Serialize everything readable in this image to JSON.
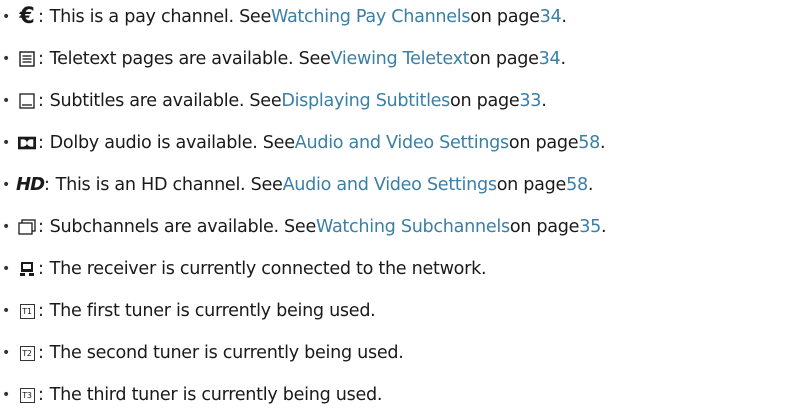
{
  "items": [
    {
      "icon": "euro-icon",
      "icon_text": "€",
      "pre": "This is a pay channel. See ",
      "link": "Watching Pay Channels",
      "mid": " on page ",
      "page": "34",
      "post": "."
    },
    {
      "icon": "teletext-icon",
      "pre": "Teletext pages are available. See ",
      "link": "Viewing Teletext",
      "mid": " on page ",
      "page": "34",
      "post": "."
    },
    {
      "icon": "subtitles-icon",
      "pre": "Subtitles are available. See ",
      "link": "Displaying Subtitles",
      "mid": " on page ",
      "page": "33",
      "post": "."
    },
    {
      "icon": "dolby-icon",
      "pre": "Dolby audio is available. See ",
      "link": "Audio and Video Settings",
      "mid": " on page ",
      "page": "58",
      "post": "."
    },
    {
      "icon": "hd-icon",
      "icon_text": "HD",
      "pre": "This is an HD channel. See ",
      "link": "Audio and Video Settings",
      "mid": " on page ",
      "page": "58",
      "post": "."
    },
    {
      "icon": "subchannels-icon",
      "pre": "Subchannels are available. See ",
      "link": "Watching Subchannels",
      "mid": " on page ",
      "page": "35",
      "post": "."
    },
    {
      "icon": "network-icon",
      "pre": "The receiver is currently connected to the network."
    },
    {
      "icon": "tuner-1-icon",
      "icon_text": "T1",
      "pre": "The first tuner is currently being used."
    },
    {
      "icon": "tuner-2-icon",
      "icon_text": "T2",
      "pre": "The second tuner is currently being used."
    },
    {
      "icon": "tuner-3-icon",
      "icon_text": "T3",
      "pre": "The third tuner is currently being used."
    }
  ],
  "separator": ":",
  "bullet": "•"
}
